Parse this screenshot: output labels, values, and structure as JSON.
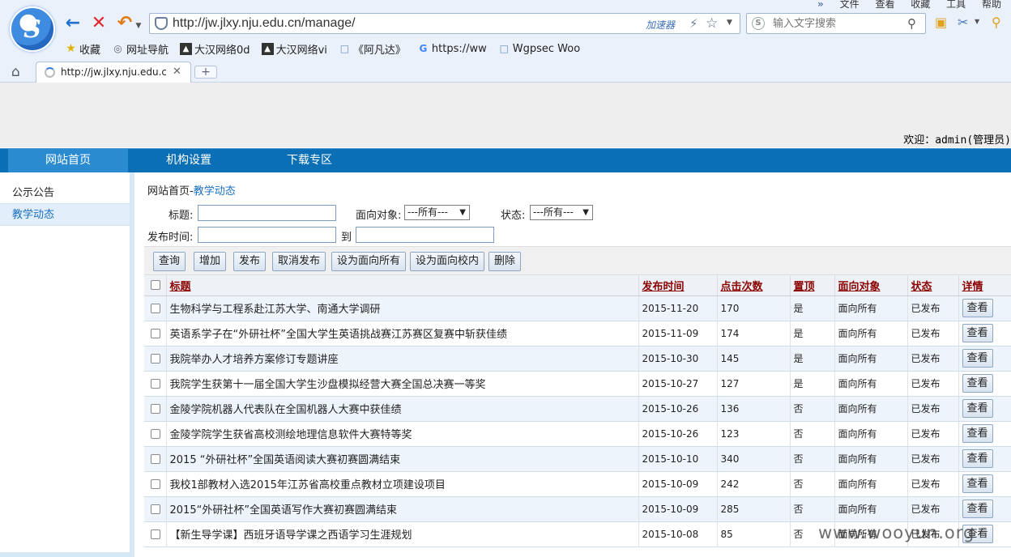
{
  "browser": {
    "menu": [
      "»",
      "文件",
      "查看",
      "收藏",
      "工具",
      "帮助"
    ],
    "address": "http://jw.jlxy.nju.edu.cn/manage/",
    "accelerator": "加速器",
    "search_placeholder": "输入文字搜索",
    "bookmarks": [
      {
        "icon": "star-icon",
        "label": "收藏"
      },
      {
        "icon": "globe-icon",
        "label": "网址导航"
      },
      {
        "icon": "site-icon",
        "label": "大汉网络0d"
      },
      {
        "icon": "site-icon",
        "label": "大汉网络vi"
      },
      {
        "icon": "page-icon",
        "label": "《阿凡达》"
      },
      {
        "icon": "google-icon",
        "label": "https://ww"
      },
      {
        "icon": "page-icon",
        "label": "Wgpsec Woo"
      }
    ],
    "tab_title": "http://jw.jlxy.nju.edu.cn",
    "tab_new": "+"
  },
  "header": {
    "welcome": "欢迎：admin(管理员)"
  },
  "mainnav": [
    "网站首页",
    "机构设置",
    "下载专区"
  ],
  "sidebar": [
    "公示公告",
    "教学动态"
  ],
  "breadcrumb": {
    "home": "网站首页-",
    "current": "教学动态"
  },
  "filters": {
    "title_label": "标题:",
    "target_label": "面向对象:",
    "target_value": "---所有---",
    "status_label": "状态:",
    "status_value": "---所有---",
    "time_label": "发布时间:",
    "to_label": "到"
  },
  "buttons": [
    "查询",
    "增加",
    "发布",
    "取消发布",
    "设为面向所有",
    "设为面向校内",
    "删除"
  ],
  "table": {
    "headers": [
      "标题",
      "发布时间",
      "点击次数",
      "置顶",
      "面向对象",
      "状态",
      "详情"
    ],
    "view_label": "查看",
    "rows": [
      {
        "title": "生物科学与工程系赴江苏大学、南通大学调研",
        "date": "2015-11-20",
        "clicks": "170",
        "top": "是",
        "target": "面向所有",
        "status": "已发布"
      },
      {
        "title": "英语系学子在“外研社杯”全国大学生英语挑战赛江苏赛区复赛中斩获佳绩",
        "date": "2015-11-09",
        "clicks": "174",
        "top": "是",
        "target": "面向所有",
        "status": "已发布"
      },
      {
        "title": "我院举办人才培养方案修订专题讲座",
        "date": "2015-10-30",
        "clicks": "145",
        "top": "是",
        "target": "面向所有",
        "status": "已发布"
      },
      {
        "title": "我院学生获第十一届全国大学生沙盘模拟经营大赛全国总决赛一等奖",
        "date": "2015-10-27",
        "clicks": "127",
        "top": "是",
        "target": "面向所有",
        "status": "已发布"
      },
      {
        "title": "金陵学院机器人代表队在全国机器人大赛中获佳绩",
        "date": "2015-10-26",
        "clicks": "136",
        "top": "否",
        "target": "面向所有",
        "status": "已发布"
      },
      {
        "title": "金陵学院学生获省高校测绘地理信息软件大赛特等奖",
        "date": "2015-10-26",
        "clicks": "123",
        "top": "否",
        "target": "面向所有",
        "status": "已发布"
      },
      {
        "title": "2015 “外研社杯”全国英语阅读大赛初赛圆满结束",
        "date": "2015-10-10",
        "clicks": "340",
        "top": "否",
        "target": "面向所有",
        "status": "已发布"
      },
      {
        "title": "我校1部教材入选2015年江苏省高校重点教材立项建设项目",
        "date": "2015-10-09",
        "clicks": "242",
        "top": "否",
        "target": "面向所有",
        "status": "已发布"
      },
      {
        "title": "2015“外研社杯”全国英语写作大赛初赛圆满结束",
        "date": "2015-10-09",
        "clicks": "285",
        "top": "否",
        "target": "面向所有",
        "status": "已发布"
      },
      {
        "title": "【新生导学课】西班牙语导学课之西语学习生涯规划",
        "date": "2015-10-08",
        "clicks": "85",
        "top": "否",
        "target": "面向所有",
        "status": "已发布"
      }
    ]
  },
  "watermark": "www.wooyun.org"
}
